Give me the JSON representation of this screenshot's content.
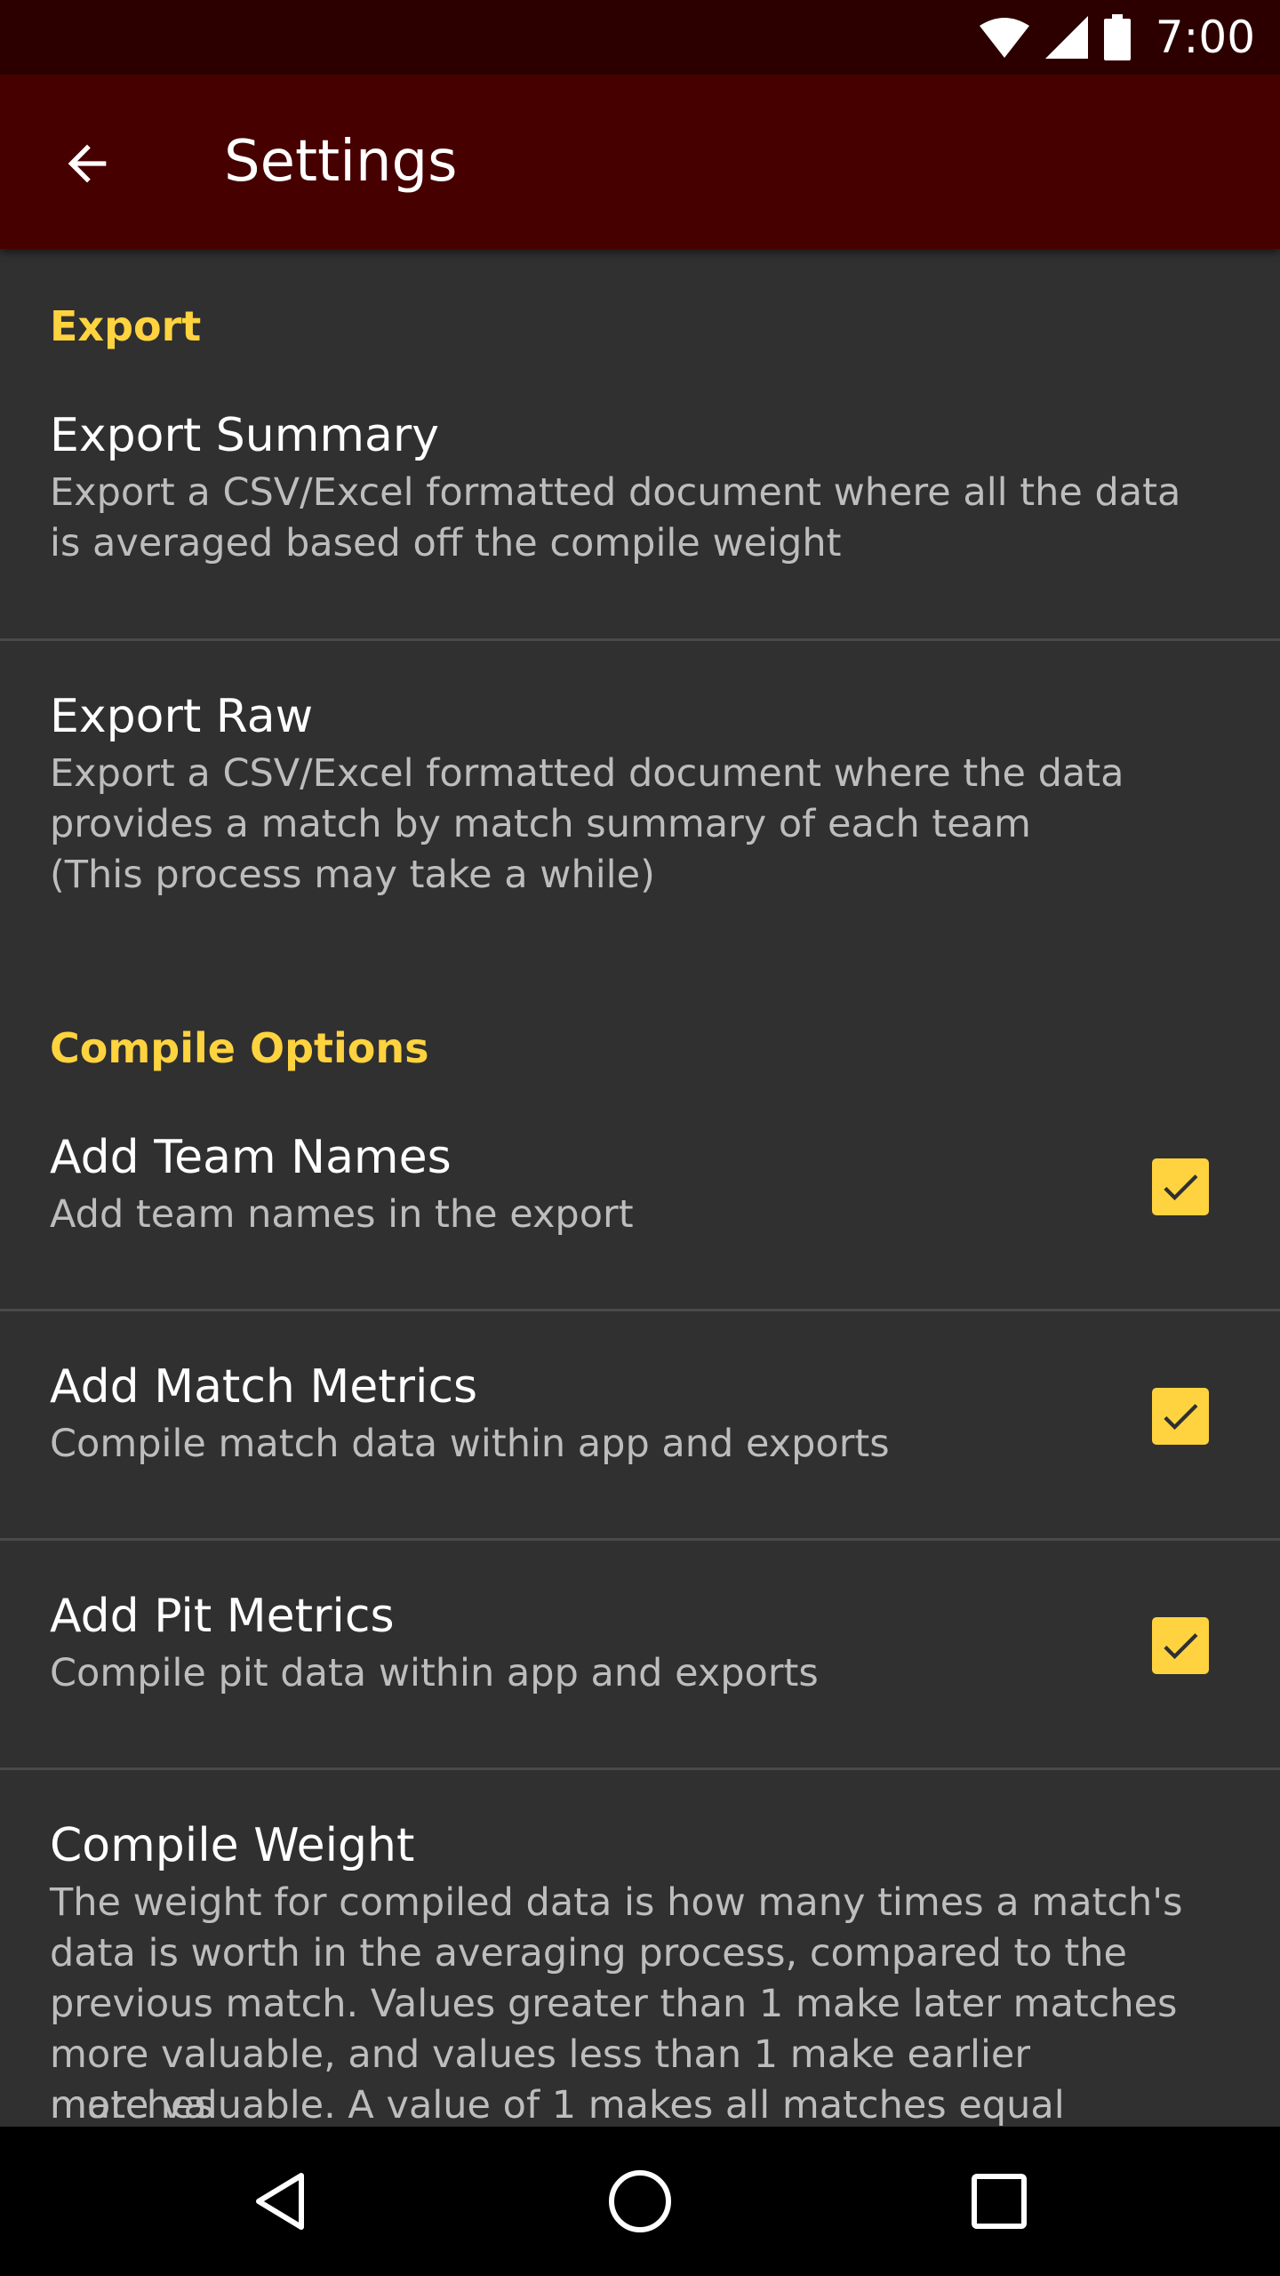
{
  "status_bar": {
    "time": "7:00",
    "icons": [
      "wifi-icon",
      "cell-signal-icon",
      "battery-icon"
    ]
  },
  "app_bar": {
    "title": "Settings",
    "back_icon": "arrow-back-icon"
  },
  "colors": {
    "status_bar": "#2d0000",
    "app_bar": "#460000",
    "background": "#303030",
    "accent": "#ffd33f"
  },
  "sections": {
    "export": {
      "header": "Export",
      "export_summary": {
        "title": "Export Summary",
        "summary_line1": "Export a CSV/Excel formatted document where all the data",
        "summary_line2": "is averaged based off the compile weight"
      },
      "export_raw": {
        "title": "Export Raw",
        "summary_line1": "Export a CSV/Excel formatted document where the data",
        "summary_line2": "provides a match by match summary of each team",
        "summary_line3": "(This process may take a while)"
      }
    },
    "compile": {
      "header": "Compile Options",
      "team_names": {
        "title": "Add Team Names",
        "summary": "Add team names in the export",
        "checked": true
      },
      "match_metrics": {
        "title": "Add Match Metrics",
        "summary": "Compile match data within app and exports",
        "checked": true
      },
      "pit_metrics": {
        "title": "Add Pit Metrics",
        "summary": "Compile pit data within app and exports",
        "checked": true
      },
      "compile_weight": {
        "title": "Compile Weight",
        "summary_line1": "The weight for compiled data is how many times a match's",
        "summary_line2": "data is worth in the averaging process, compared to the",
        "summary_line3": "previous match. Values greater than 1 make later matches",
        "summary_line4": "more valuable, and values less than 1 make earlier matches",
        "summary_line5": "more valuable. A value of 1 makes all matches equal"
      }
    }
  },
  "nav_bar": {
    "icons": [
      "nav-back-icon",
      "nav-home-icon",
      "nav-recents-icon"
    ]
  }
}
